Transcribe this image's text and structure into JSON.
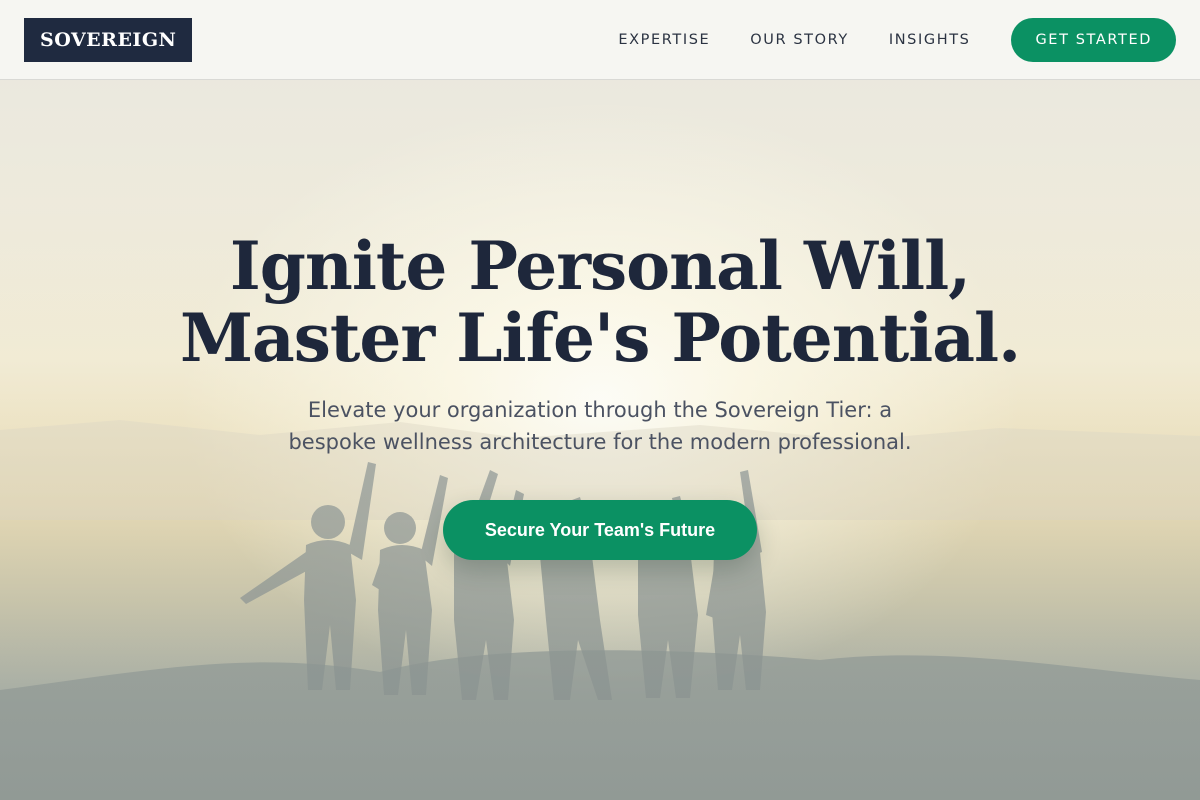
{
  "header": {
    "logo": "SOVEREIGN",
    "nav": [
      {
        "label": "EXPERTISE"
      },
      {
        "label": "OUR STORY"
      },
      {
        "label": "INSIGHTS"
      }
    ],
    "cta_label": "GET STARTED"
  },
  "hero": {
    "title_line1": "Ignite Personal Will,",
    "title_line2": "Master Life's Potential.",
    "subtitle_line1": "Elevate your organization through the Sovereign Tier: a",
    "subtitle_line2": "bespoke wellness architecture for the modern professional.",
    "cta_label": "Secure Your Team's Future"
  },
  "colors": {
    "brand_navy": "#1f2a40",
    "accent_green": "#0b9163",
    "text_dark": "#1e273b",
    "text_muted": "#4b5262"
  }
}
